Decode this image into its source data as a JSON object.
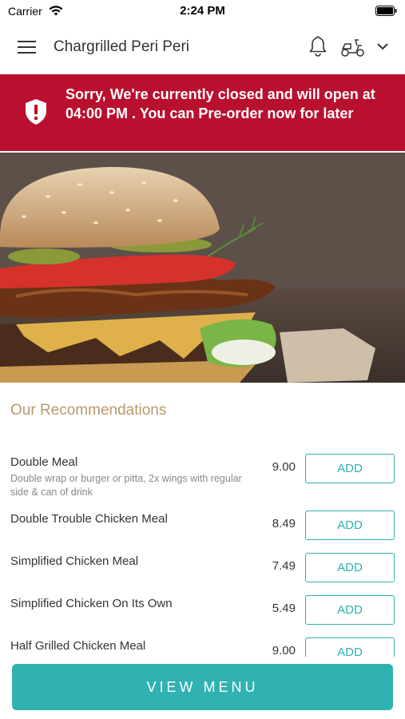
{
  "status_bar": {
    "carrier": "Carrier",
    "time": "2:24 PM"
  },
  "nav": {
    "title": "Chargrilled Peri Peri"
  },
  "banner": {
    "message": "Sorry, We're currently closed and will open at 04:00 PM . You can Pre-order now for later",
    "color": "#b8102e"
  },
  "recommendations": {
    "title": "Our Recommendations",
    "items": [
      {
        "name": "Double Meal",
        "description": "Double wrap or burger or pitta, 2x wings with regular side & can of drink",
        "price": "9.00",
        "add_label": "ADD"
      },
      {
        "name": "Double Trouble Chicken Meal",
        "description": "",
        "price": "8.49",
        "add_label": "ADD"
      },
      {
        "name": "Simplified Chicken Meal",
        "description": "",
        "price": "7.49",
        "add_label": "ADD"
      },
      {
        "name": "Simplified Chicken On Its Own",
        "description": "",
        "price": "5.49",
        "add_label": "ADD"
      },
      {
        "name": "Half Grilled Chicken Meal",
        "description": "",
        "price": "9.00",
        "add_label": "ADD"
      }
    ]
  },
  "footer": {
    "view_menu_label": "VIEW MENU"
  },
  "colors": {
    "accent": "#30b2b0",
    "section_title": "#b79a6b"
  },
  "icons": [
    "wifi-icon",
    "battery-icon",
    "menu-icon",
    "bell-icon",
    "scooter-icon",
    "chevron-down-icon",
    "shield-icon"
  ]
}
